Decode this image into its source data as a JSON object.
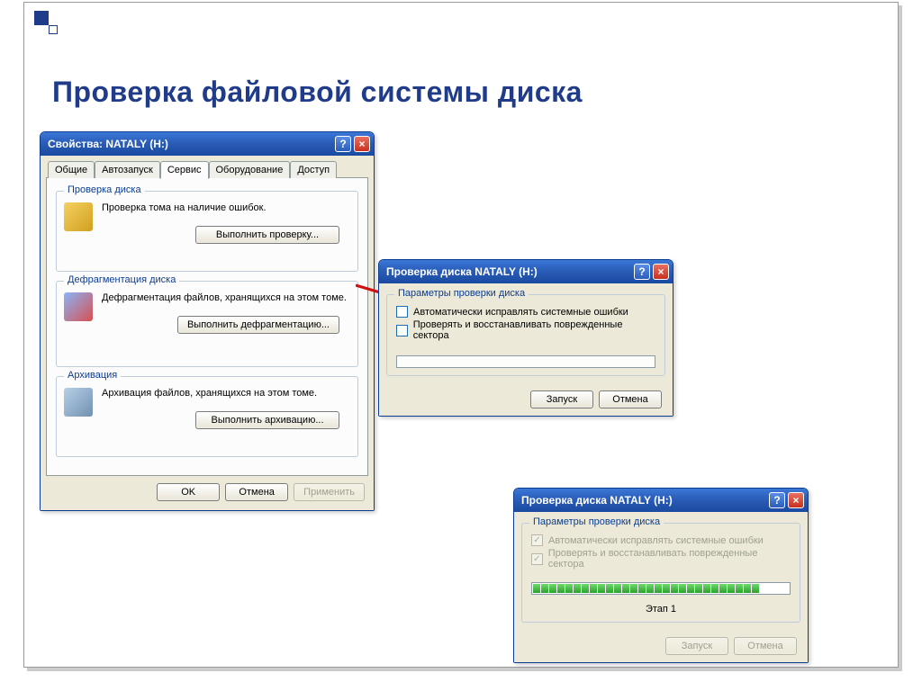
{
  "slide": {
    "title": "Проверка файловой системы диска"
  },
  "props_window": {
    "title": "Свойства: NATALY (H:)",
    "tabs": [
      "Общие",
      "Автозапуск",
      "Сервис",
      "Оборудование",
      "Доступ"
    ],
    "active_tab": 2,
    "groups": {
      "check": {
        "legend": "Проверка диска",
        "label": "Проверка тома на наличие ошибок.",
        "button": "Выполнить проверку..."
      },
      "defrag": {
        "legend": "Дефрагментация диска",
        "label": "Дефрагментация файлов, хранящихся на этом томе.",
        "button": "Выполнить дефрагментацию..."
      },
      "backup": {
        "legend": "Архивация",
        "label": "Архивация файлов, хранящихся на этом томе.",
        "button": "Выполнить архивацию..."
      }
    },
    "buttons": {
      "ok": "OK",
      "cancel": "Отмена",
      "apply": "Применить"
    }
  },
  "check_dialog": {
    "title": "Проверка диска NATALY (H:)",
    "legend": "Параметры проверки диска",
    "opt1": "Автоматически исправлять системные ошибки",
    "opt2": "Проверять и восстанавливать поврежденные сектора",
    "buttons": {
      "start": "Запуск",
      "cancel": "Отмена"
    }
  },
  "check_running": {
    "title": "Проверка диска NATALY (H:)",
    "legend": "Параметры проверки диска",
    "opt1": "Автоматически исправлять системные ошибки",
    "opt2": "Проверять и восстанавливать поврежденные сектора",
    "stage": "Этап 1",
    "buttons": {
      "start": "Запуск",
      "cancel": "Отмена"
    },
    "progress_segments": 28
  }
}
